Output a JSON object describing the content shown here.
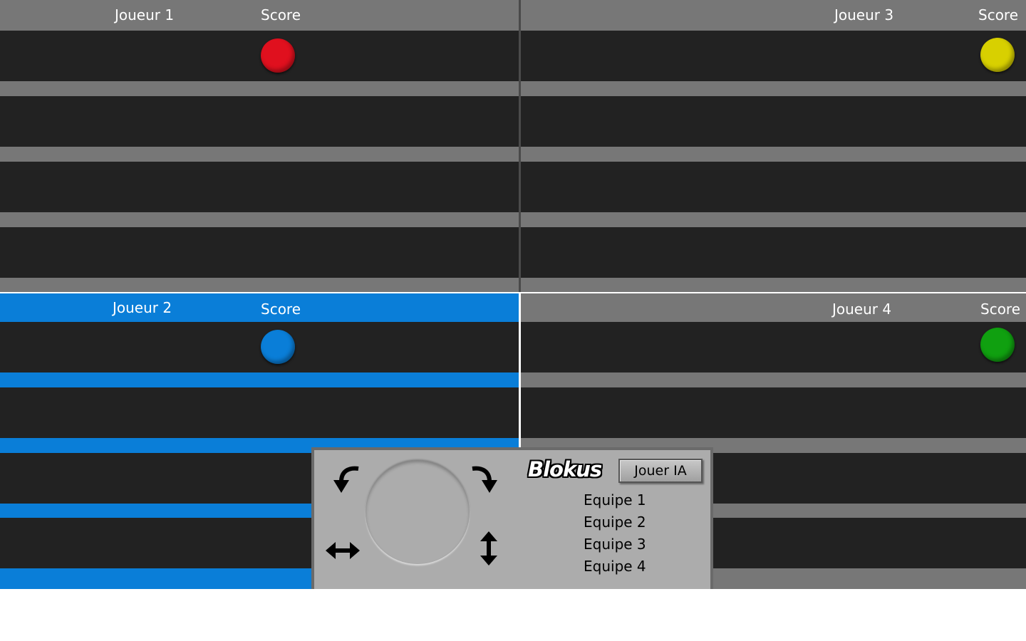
{
  "players": [
    {
      "id": "joueur-1",
      "name": "Joueur 1",
      "score_label": "Score",
      "color": "#e0101e",
      "stripe": "#777777",
      "active": false
    },
    {
      "id": "joueur-2",
      "name": "Joueur 2",
      "score_label": "Score",
      "color": "#0a7ed8",
      "stripe": "#0a7ed8",
      "active": true
    },
    {
      "id": "joueur-3",
      "name": "Joueur 3",
      "score_label": "Score",
      "color": "#d8d000",
      "stripe": "#777777",
      "active": false
    },
    {
      "id": "joueur-4",
      "name": "Joueur 4",
      "score_label": "Score",
      "color": "#10a010",
      "stripe": "#777777",
      "active": false
    }
  ],
  "controls": {
    "logo": "Blokus",
    "ai_button": "Jouer IA",
    "teams": [
      "Equipe 1",
      "Equipe 2",
      "Equipe 3",
      "Equipe 4"
    ],
    "icons": [
      "rotate-left-icon",
      "rotate-right-icon",
      "flip-horizontal-icon",
      "flip-vertical-icon",
      "piece-preview-circle"
    ]
  }
}
